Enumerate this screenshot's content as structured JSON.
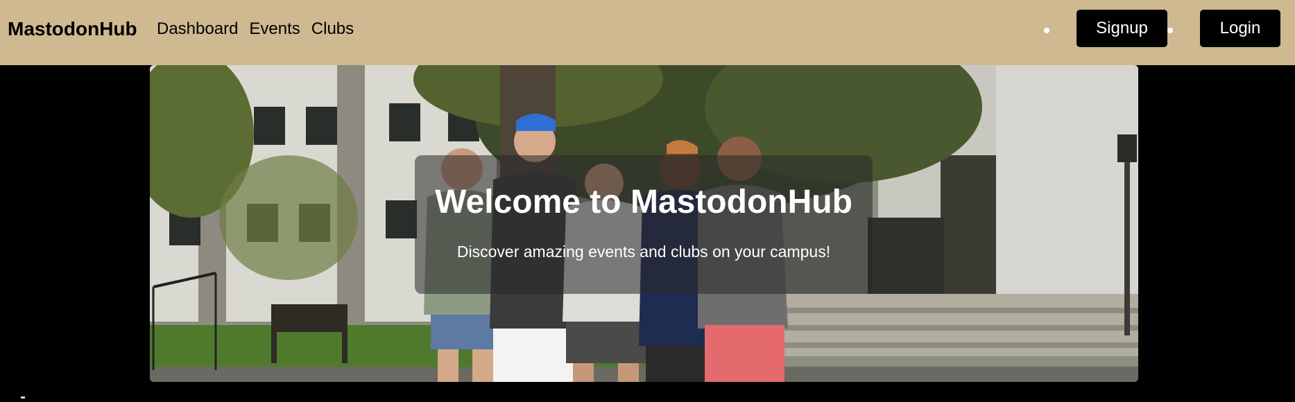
{
  "navbar": {
    "brand": "MastodonHub",
    "links": [
      {
        "label": "Dashboard"
      },
      {
        "label": "Events"
      },
      {
        "label": "Clubs"
      }
    ],
    "signup_label": "Signup",
    "login_label": "Login",
    "background_color": "#cfb991"
  },
  "hero": {
    "title": "Welcome to MastodonHub",
    "subtitle": "Discover amazing events and clubs on your campus!",
    "image_description": "students-in-front-of-campus-building"
  }
}
